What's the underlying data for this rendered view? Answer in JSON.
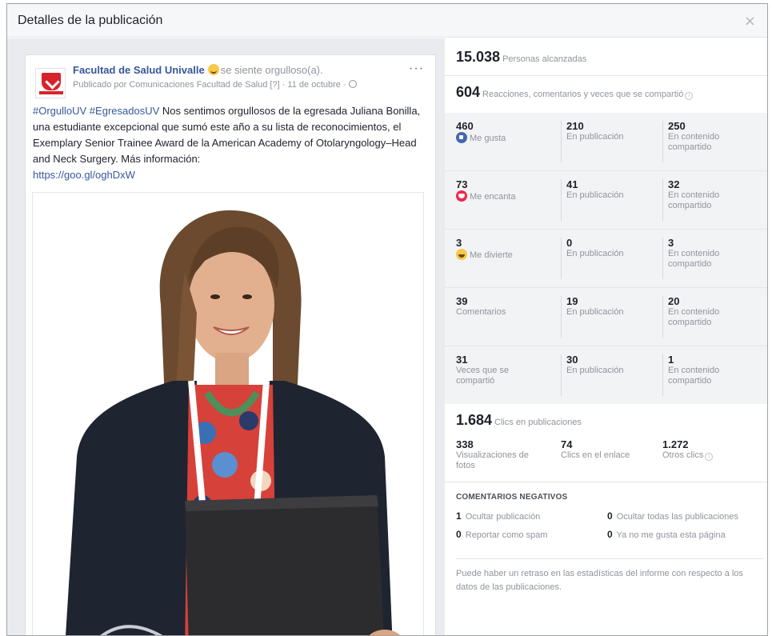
{
  "dialog": {
    "title": "Detalles de la publicación",
    "close_icon": "close-x-icon"
  },
  "post": {
    "page_name": "Facultad de Salud Univalle",
    "feeling": "se siente orgulloso(a).",
    "meta": "Publicado por Comunicaciones Facultad de Salud [?] · 11 de octubre ·",
    "more": "···",
    "hashtags": "#OrgulloUV #EgresadosUV",
    "body": " Nos sentimos orgullosos de la egresada Juliana Bonilla, una estudiante excepcional que sumó este año a su lista de reconocimientos, el Exemplary Senior Trainee Award de la American Academy of Otolaryngology–Head and Neck Surgery. Más información:",
    "link": "https://goo.gl/oghDxW"
  },
  "stats": {
    "reach": {
      "value": "15.038",
      "label": "Personas alcanzadas"
    },
    "engagement": {
      "value": "604",
      "label": "Reacciones, comentarios y veces que se compartió"
    },
    "rows": [
      {
        "total": "460",
        "label": "Me gusta",
        "icon": "like-icon",
        "in_post": "210",
        "in_post_label": "En publicación",
        "shared": "250",
        "shared_label": "En contenido compartido"
      },
      {
        "total": "73",
        "label": "Me encanta",
        "icon": "love-icon",
        "in_post": "41",
        "in_post_label": "En publicación",
        "shared": "32",
        "shared_label": "En contenido compartido"
      },
      {
        "total": "3",
        "label": "Me divierte",
        "icon": "haha-icon",
        "in_post": "0",
        "in_post_label": "En publicación",
        "shared": "3",
        "shared_label": "En contenido compartido"
      },
      {
        "total": "39",
        "label": "Comentarios",
        "icon": "",
        "in_post": "19",
        "in_post_label": "En publicación",
        "shared": "20",
        "shared_label": "En contenido compartido"
      },
      {
        "total": "31",
        "label": "Veces que se compartió",
        "icon": "",
        "in_post": "30",
        "in_post_label": "En publicación",
        "shared": "1",
        "shared_label": "En contenido compartido"
      }
    ],
    "clicks": {
      "value": "1.684",
      "label": "Clics en publicaciones",
      "items": [
        {
          "value": "338",
          "label": "Visualizaciones de fotos"
        },
        {
          "value": "74",
          "label": "Clics en el enlace"
        },
        {
          "value": "1.272",
          "label": "Otros clics"
        }
      ]
    },
    "negative": {
      "title": "COMENTARIOS NEGATIVOS",
      "items": [
        {
          "value": "1",
          "label": "Ocultar publicación"
        },
        {
          "value": "0",
          "label": "Ocultar todas las publicaciones"
        },
        {
          "value": "0",
          "label": "Reportar como spam"
        },
        {
          "value": "0",
          "label": "Ya no me gusta esta página"
        }
      ]
    },
    "footnote": "Puede haber un retraso en las estadísticas del informe con respecto a los datos de las publicaciones."
  },
  "colors": {
    "link": "#365899",
    "muted": "#90949c",
    "like": "#4267b2",
    "love": "#f0284a",
    "haha": "#f7c948",
    "brand": "#d8232a"
  }
}
